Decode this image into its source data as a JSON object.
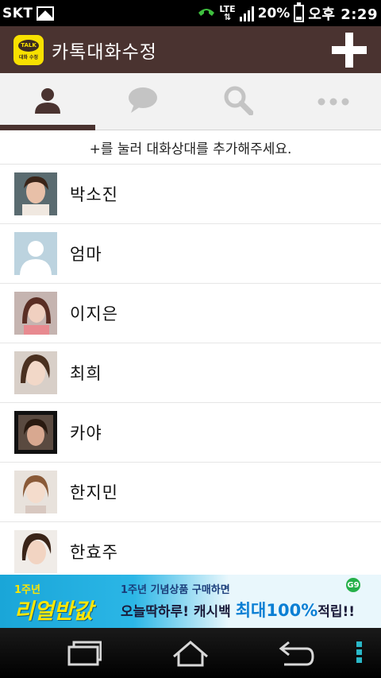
{
  "status": {
    "carrier": "SKT",
    "network": "LTE",
    "battery": "20%",
    "time": "오후 2:29",
    "icons": [
      "image-icon",
      "phone-call-icon",
      "signal-icon",
      "battery-icon"
    ]
  },
  "appbar": {
    "logo_text": "TALK",
    "logo_sub": "대화 수정",
    "title": "카톡대화수정",
    "add_icon": "plus-icon"
  },
  "tabs": [
    {
      "icon": "person-icon",
      "active": true
    },
    {
      "icon": "chat-bubble-icon",
      "active": false
    },
    {
      "icon": "search-icon",
      "active": false
    },
    {
      "icon": "more-icon",
      "active": false
    }
  ],
  "hint": "+를 눌러 대화상대를 추가해주세요.",
  "contacts": [
    {
      "name": "박소진",
      "avatar": "photo"
    },
    {
      "name": "엄마",
      "avatar": "default"
    },
    {
      "name": "이지은",
      "avatar": "photo"
    },
    {
      "name": "최희",
      "avatar": "photo"
    },
    {
      "name": "카야",
      "avatar": "photo"
    },
    {
      "name": "한지민",
      "avatar": "photo"
    },
    {
      "name": "한효주",
      "avatar": "photo"
    }
  ],
  "ad": {
    "left_small": "1주년",
    "left_big": "리얼반값",
    "line1": "1주년 기념상품 구매하면",
    "line2_a": "오늘딱하루! 캐시백 ",
    "line2_b": "최대100%",
    "line2_c": "적립!!",
    "logo": "G9"
  },
  "colors": {
    "appbar": "#4a3330",
    "logo_yellow": "#f7e000",
    "tab_background": "#f2f2f2"
  }
}
